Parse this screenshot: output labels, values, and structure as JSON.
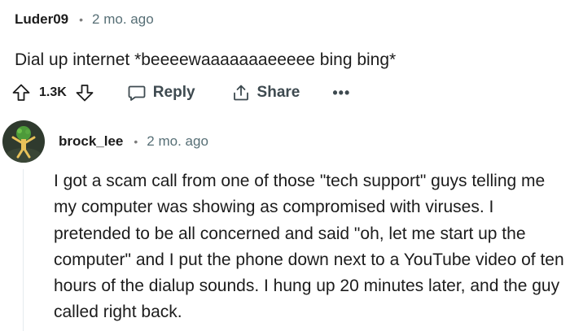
{
  "comment1": {
    "author": "Luder09",
    "separator": "•",
    "time": "2 mo. ago",
    "body": "Dial up internet *beeeewaaaaaaaeeeee bing bing*",
    "actions": {
      "score": "1.3K",
      "reply_label": "Reply",
      "share_label": "Share",
      "more_label": "•••"
    }
  },
  "comment2": {
    "author": "brock_lee",
    "separator": "•",
    "time": "2 mo. ago",
    "body": "I got a scam call from one of those \"tech support\" guys telling me my computer was showing as compromised with viruses. I pretended to be all concerned and said \"oh, let me start up the computer\" and I put the phone down next to a YouTube video of ten hours of the dialup sounds. I hung up 20 minutes later, and the guy called right back."
  },
  "colors": {
    "text": "#1c1c1c",
    "meta": "#576f76",
    "action": "#3e4a50",
    "thread_line": "#e5ebee",
    "avatar_bg": "#2f3a2e"
  },
  "icons": [
    "upvote-icon",
    "downvote-icon",
    "comment-icon",
    "share-icon",
    "more-icon"
  ]
}
